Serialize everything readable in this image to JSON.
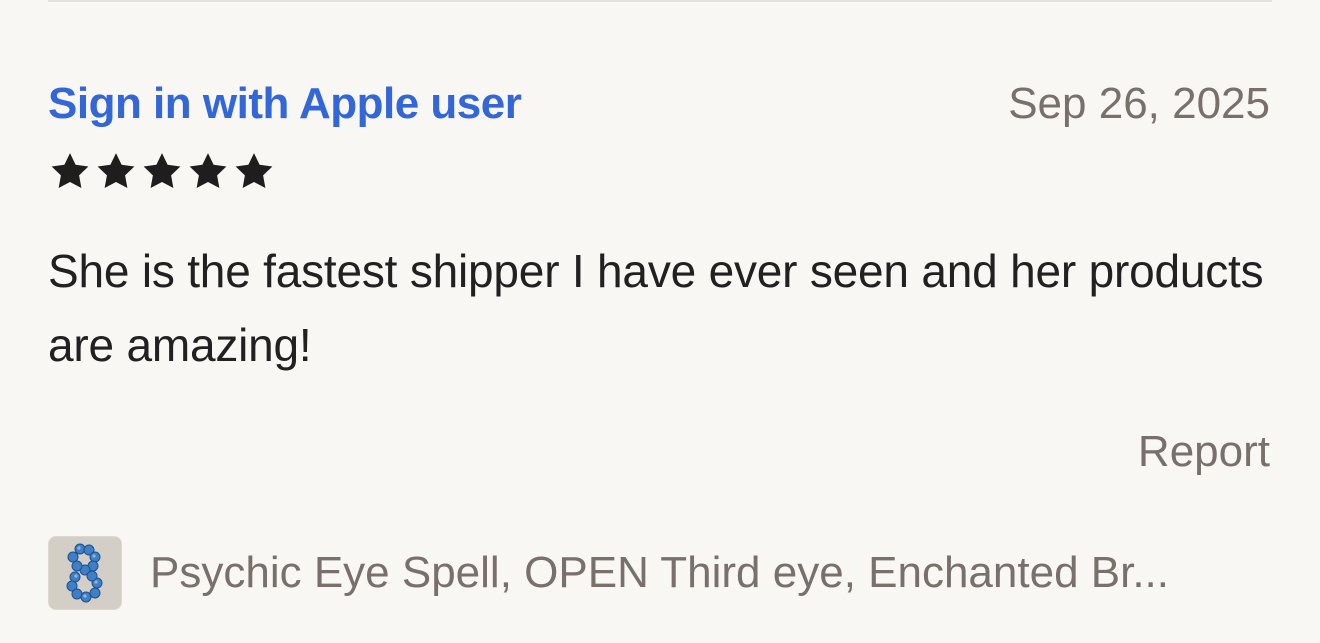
{
  "review": {
    "reviewer_name": "Sign in with Apple user",
    "date": "Sep 26, 2025",
    "rating": 5,
    "rating_max": 5,
    "text": "She is the fastest shipper I have ever seen and her products are amazing!",
    "report_label": "Report"
  },
  "product": {
    "title": "Psychic Eye Spell, OPEN Third eye, Enchanted Br...",
    "thumbnail_icon": "bead-bracelet-thumbnail"
  },
  "colors": {
    "background": "#f8f7f4",
    "link_blue": "#3366d6",
    "muted_text": "#7a706b",
    "body_text": "#222020",
    "star": "#1f1d1d"
  }
}
